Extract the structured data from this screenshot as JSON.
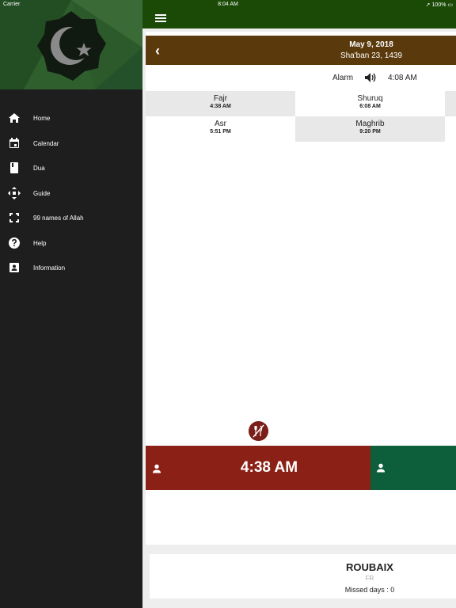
{
  "status_bar": {
    "carrier": "Carrier",
    "time": "8:04 AM",
    "battery": "100%"
  },
  "menu": [
    {
      "label": "Home",
      "icon": "home-icon"
    },
    {
      "label": "Calendar",
      "icon": "calendar-icon"
    },
    {
      "label": "Dua",
      "icon": "book-icon"
    },
    {
      "label": "Guide",
      "icon": "move-arrows-icon"
    },
    {
      "label": "99 names of Allah",
      "icon": "fullscreen-icon"
    },
    {
      "label": "Help",
      "icon": "help-icon"
    },
    {
      "label": "Information",
      "icon": "contact-card-icon"
    }
  ],
  "date": {
    "gregorian": "May 9, 2018",
    "hijri": "Sha'ban 23, 1439"
  },
  "alarm": {
    "label": "Alarm",
    "time": "4:08 AM"
  },
  "prayers": [
    {
      "name": "Fajr",
      "time": "4:38 AM"
    },
    {
      "name": "Shuruq",
      "time": "6:08 AM"
    },
    {
      "name": "Asr",
      "time": "5:51 PM"
    },
    {
      "name": "Maghrib",
      "time": "9:20 PM"
    }
  ],
  "countdown": {
    "time": "4:38 AM"
  },
  "location": {
    "city": "ROUBAIX",
    "country": "FR",
    "missed_days": "Missed days : 0"
  },
  "colors": {
    "topbar": "#1b4a07",
    "datebar": "#5a3a0c",
    "red": "#8b2116",
    "green": "#0c5f3a",
    "sidebar": "#1e1e1e"
  }
}
